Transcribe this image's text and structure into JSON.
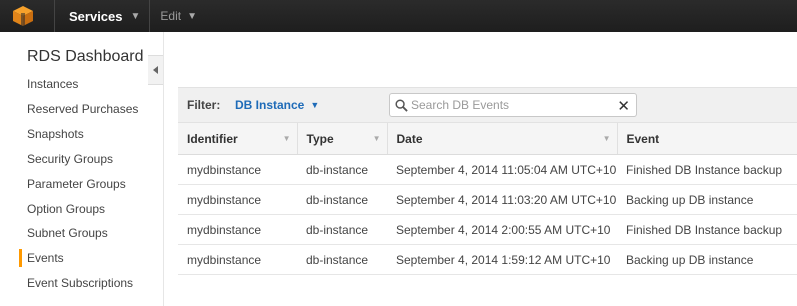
{
  "topnav": {
    "services_label": "Services",
    "edit_label": "Edit"
  },
  "sidebar": {
    "title": "RDS Dashboard",
    "items": [
      {
        "label": "Instances"
      },
      {
        "label": "Reserved Purchases"
      },
      {
        "label": "Snapshots"
      },
      {
        "label": "Security Groups"
      },
      {
        "label": "Parameter Groups"
      },
      {
        "label": "Option Groups"
      },
      {
        "label": "Subnet Groups"
      },
      {
        "label": "Events"
      },
      {
        "label": "Event Subscriptions"
      }
    ],
    "active_item": "Events"
  },
  "filter": {
    "label": "Filter:",
    "selected": "DB Instance",
    "search_placeholder": "Search DB Events"
  },
  "table": {
    "columns": [
      "Identifier",
      "Type",
      "Date",
      "Event"
    ],
    "rows": [
      [
        "mydbinstance",
        "db-instance",
        "September 4, 2014 11:05:04 AM UTC+10",
        "Finished DB Instance backup"
      ],
      [
        "mydbinstance",
        "db-instance",
        "September 4, 2014 11:03:20 AM UTC+10",
        "Backing up DB instance"
      ],
      [
        "mydbinstance",
        "db-instance",
        "September 4, 2014 2:00:55 AM UTC+10",
        "Finished DB Instance backup"
      ],
      [
        "mydbinstance",
        "db-instance",
        "September 4, 2014 1:59:12 AM UTC+10",
        "Backing up DB instance"
      ]
    ]
  },
  "colors": {
    "topbar": "#232323",
    "accent": "#ff9900",
    "link": "#1e6bb8"
  }
}
